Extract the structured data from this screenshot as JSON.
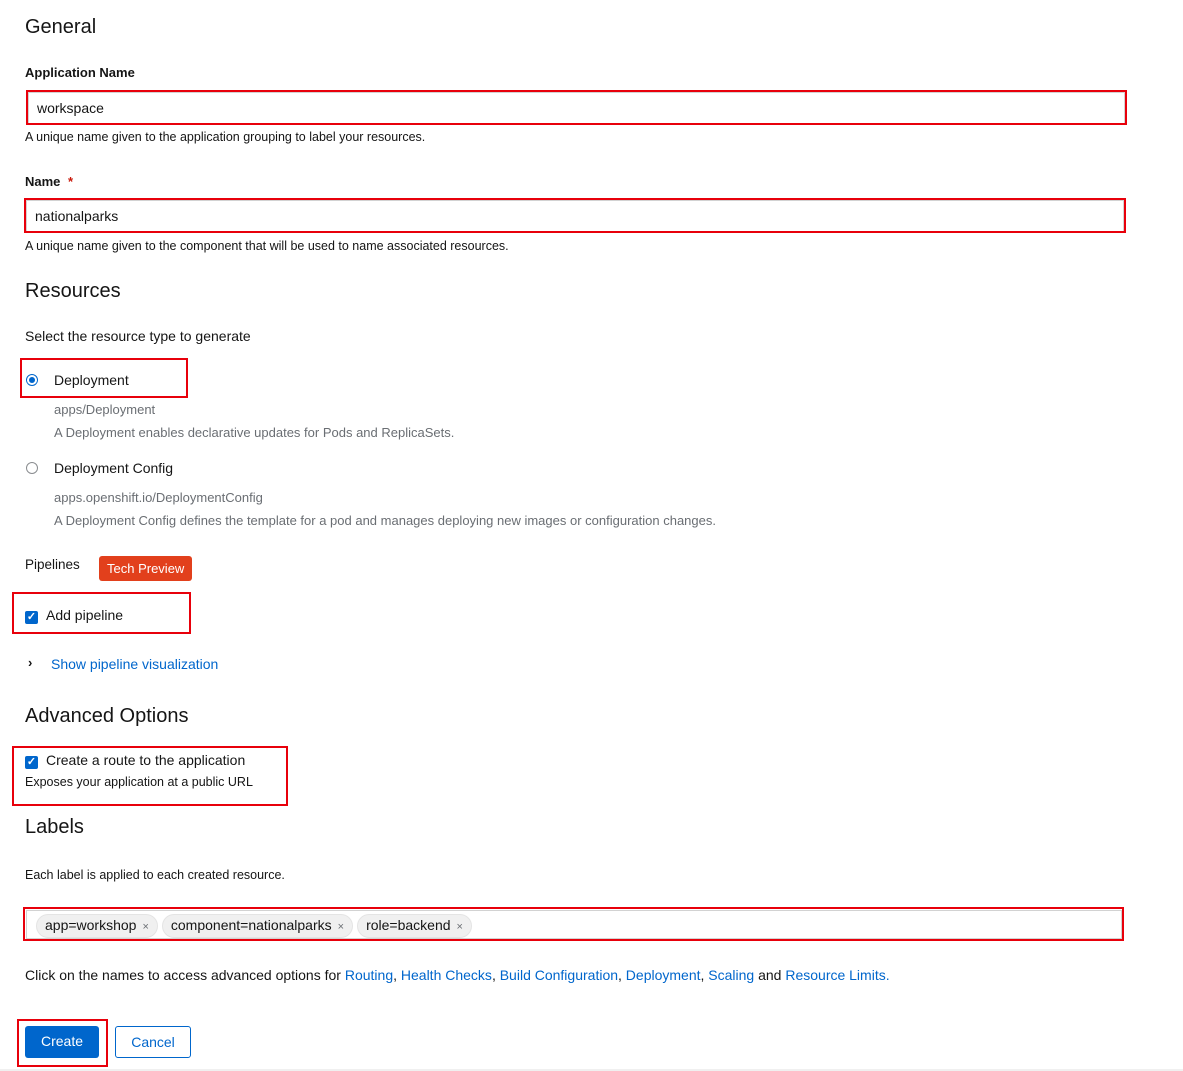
{
  "general": {
    "heading": "General",
    "app_name_label": "Application Name",
    "app_name_value": "workspace",
    "app_name_help": "A unique name given to the application grouping to label your resources.",
    "name_label": "Name",
    "required_marker": "*",
    "name_value": "nationalparks",
    "name_help": "A unique name given to the component that will be used to name associated resources."
  },
  "resources": {
    "heading": "Resources",
    "prompt": "Select the resource type to generate",
    "options": [
      {
        "label": "Deployment",
        "api": "apps/Deployment",
        "description": "A Deployment enables declarative updates for Pods and ReplicaSets.",
        "selected": true
      },
      {
        "label": "Deployment Config",
        "api": "apps.openshift.io/DeploymentConfig",
        "description": "A Deployment Config defines the template for a pod and manages deploying new images or configuration changes.",
        "selected": false
      }
    ]
  },
  "pipelines": {
    "label": "Pipelines",
    "badge": "Tech Preview",
    "add_pipeline_label": "Add pipeline",
    "add_pipeline_checked": true,
    "show_visualization": "Show pipeline visualization"
  },
  "advanced": {
    "heading": "Advanced Options",
    "route_label": "Create a route to the application",
    "route_checked": true,
    "route_help": "Exposes your application at a public URL"
  },
  "labels": {
    "heading": "Labels",
    "help": "Each label is applied to each created resource.",
    "chips": [
      "app=workshop",
      "component=nationalparks",
      "role=backend"
    ],
    "remove_glyph": "×"
  },
  "footer_note": {
    "prefix": "Click on the names to access advanced options for",
    "links": [
      "Routing",
      "Health Checks",
      "Build Configuration",
      "Deployment",
      "Scaling",
      "Resource Limits"
    ],
    "sep": ",",
    "and": "and",
    "end": "."
  },
  "actions": {
    "create": "Create",
    "cancel": "Cancel"
  },
  "colors": {
    "primary": "#0066cc",
    "badge": "#e2401c",
    "highlight": "#e8000b"
  }
}
